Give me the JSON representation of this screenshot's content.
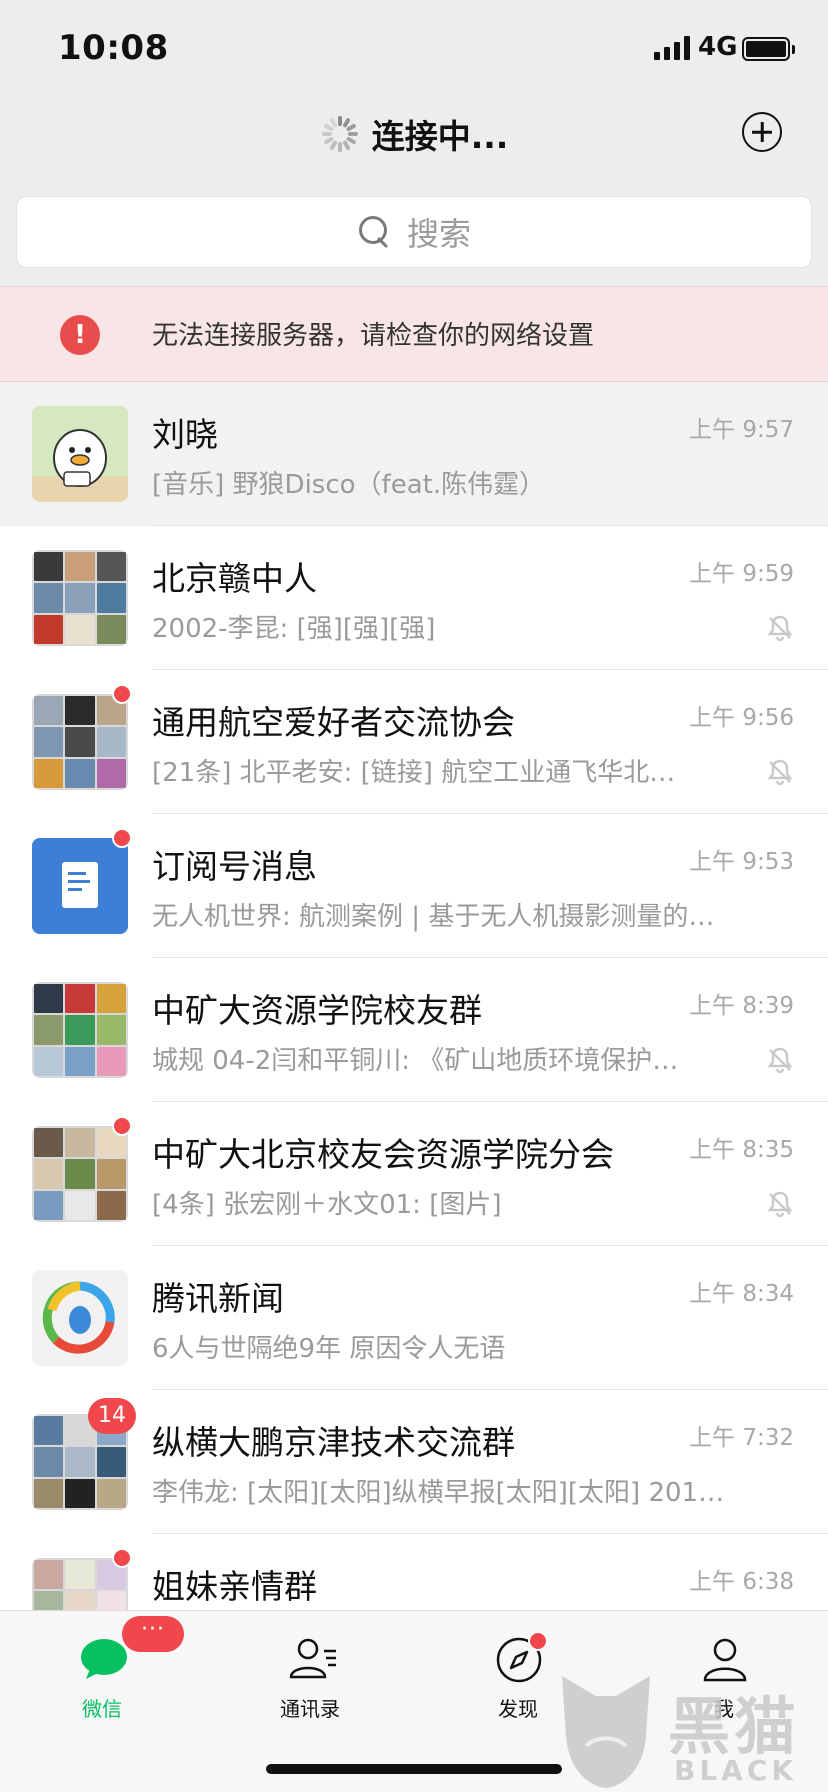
{
  "status_bar": {
    "time": "10:08",
    "network": "4G"
  },
  "nav": {
    "title": "连接中..."
  },
  "search": {
    "placeholder": "搜索"
  },
  "alert": {
    "text": "无法连接服务器，请检查你的网络设置"
  },
  "chats": [
    {
      "name": "刘晓",
      "preview": "[音乐] 野狼Disco（feat.陈伟霆）",
      "time": "上午 9:57",
      "muted": false,
      "pinned": true
    },
    {
      "name": "北京赣中人",
      "preview": "2002-李昆: [强][强][强]",
      "time": "上午 9:59",
      "muted": true
    },
    {
      "name": "通用航空爱好者交流协会",
      "preview": "[21条] 北平老安: [链接] 航空工业通飞华北…",
      "time": "上午 9:56",
      "muted": true,
      "unread_dot": true
    },
    {
      "name": "订阅号消息",
      "preview": "无人机世界: 航测案例 | 基于无人机摄影测量的…",
      "time": "上午 9:53",
      "muted": false,
      "unread_dot": true
    },
    {
      "name": "中矿大资源学院校友群",
      "preview": "城规 04-2闫和平铜川: 《矿山地质环境保护…",
      "time": "上午 8:39",
      "muted": true
    },
    {
      "name": "中矿大北京校友会资源学院分会",
      "preview": "[4条] 张宏刚＋水文01: [图片]",
      "time": "上午 8:35",
      "muted": true,
      "unread_dot": true
    },
    {
      "name": "腾讯新闻",
      "preview": "6人与世隔绝9年 原因令人无语",
      "time": "上午 8:34",
      "muted": false
    },
    {
      "name": "纵横大鹏京津技术交流群",
      "preview": "李伟龙: [太阳][太阳]纵横早报[太阳][太阳]  2019…",
      "time": "上午 7:32",
      "muted": false,
      "unread_count": "14"
    },
    {
      "name": "姐妹亲情群",
      "preview": "",
      "time": "上午 6:38",
      "muted": false,
      "unread_dot": true
    }
  ],
  "tabs": [
    {
      "label": "微信",
      "icon": "chat-bubble-icon",
      "active": true
    },
    {
      "label": "通讯录",
      "icon": "contacts-icon"
    },
    {
      "label": "发现",
      "icon": "compass-icon"
    },
    {
      "label": "我",
      "icon": "person-icon"
    }
  ],
  "tab_badge": "···",
  "colors": {
    "accent_green": "#07c160",
    "badge_red": "#f0474c",
    "alert_bg": "#f8e6e6"
  },
  "watermark": {
    "title": "黑猫",
    "subtitle": "BLACK CAT"
  }
}
